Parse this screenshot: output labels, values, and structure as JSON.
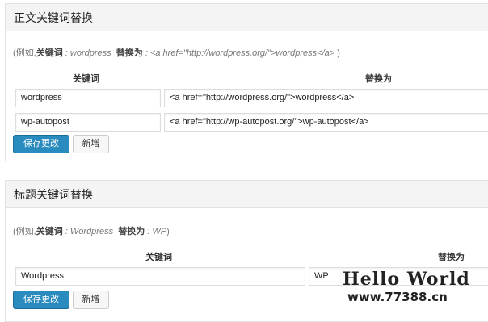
{
  "content_section": {
    "title": "正文关键词替换",
    "example": {
      "open": "(例如,",
      "keyword_label": "关键词",
      "sep1": " : ",
      "keyword_value": "wordpress",
      "replace_label": "替换为",
      "sep2": " : ",
      "replace_value": "<a href=\"http://wordpress.org/\">wordpress</a>",
      "close": " )"
    },
    "col_keyword": "关键词",
    "col_replace": "替换为",
    "rows": [
      {
        "keyword": "wordpress",
        "replacement": "<a href=\"http://wordpress.org/\">wordpress</a>"
      },
      {
        "keyword": "wp-autopost",
        "replacement": "<a href=\"http://wp-autopost.org/\">wp-autopost</a>"
      }
    ],
    "save_label": "保存更改",
    "add_label": "新增"
  },
  "title_section": {
    "title": "标题关键词替换",
    "example": {
      "open": "(例如,",
      "keyword_label": "关键词",
      "sep1": " : ",
      "keyword_value": "Wordpress",
      "replace_label": "替换为",
      "sep2": " : ",
      "replace_value": "WP",
      "close": ")"
    },
    "col_keyword": "关键词",
    "col_replace": "替换为",
    "rows": [
      {
        "keyword": "Wordpress",
        "replacement": "WP"
      }
    ],
    "save_label": "保存更改",
    "add_label": "新增"
  },
  "watermark": {
    "title": "Hello World",
    "url": "www.77388.cn"
  },
  "colors": {
    "primary_button": "#2a8bbf",
    "header_bg": "#f4f4f4"
  }
}
